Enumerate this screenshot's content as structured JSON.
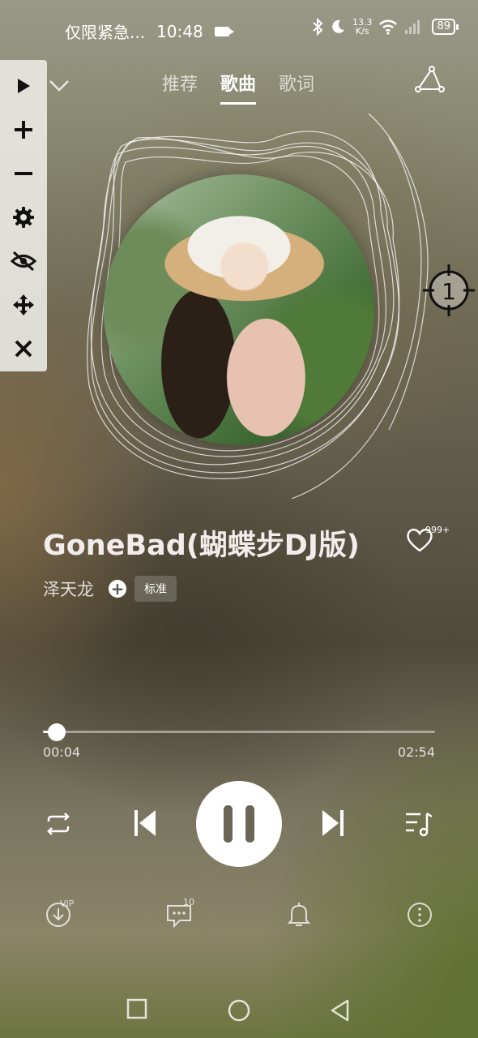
{
  "status_bar": {
    "notification_text": "仅限紧急...",
    "time": "10:48",
    "network_speed_value": "13.3",
    "network_speed_unit": "K/s",
    "battery": "89"
  },
  "nav": {
    "tabs": [
      {
        "label": "推荐",
        "active": false
      },
      {
        "label": "歌曲",
        "active": true
      },
      {
        "label": "歌词",
        "active": false
      }
    ]
  },
  "floating_toolbar": {
    "items": [
      "play-icon",
      "plus-icon",
      "minus-icon",
      "gear-icon",
      "eye-slash-icon",
      "move-icon",
      "close-icon"
    ]
  },
  "target_marker": "1",
  "song": {
    "title": "GoneBad(蝴蝶步DJ版)",
    "artist": "泽天龙",
    "quality": "标准",
    "like_count": "999+"
  },
  "playback": {
    "current_time": "00:04",
    "total_time": "02:54",
    "progress": 0.036
  },
  "actions": {
    "vip_badge": "VIP",
    "comment_count": "10"
  },
  "colors": {
    "accent": "#ffffff",
    "pause_bars": "#6a6657"
  }
}
